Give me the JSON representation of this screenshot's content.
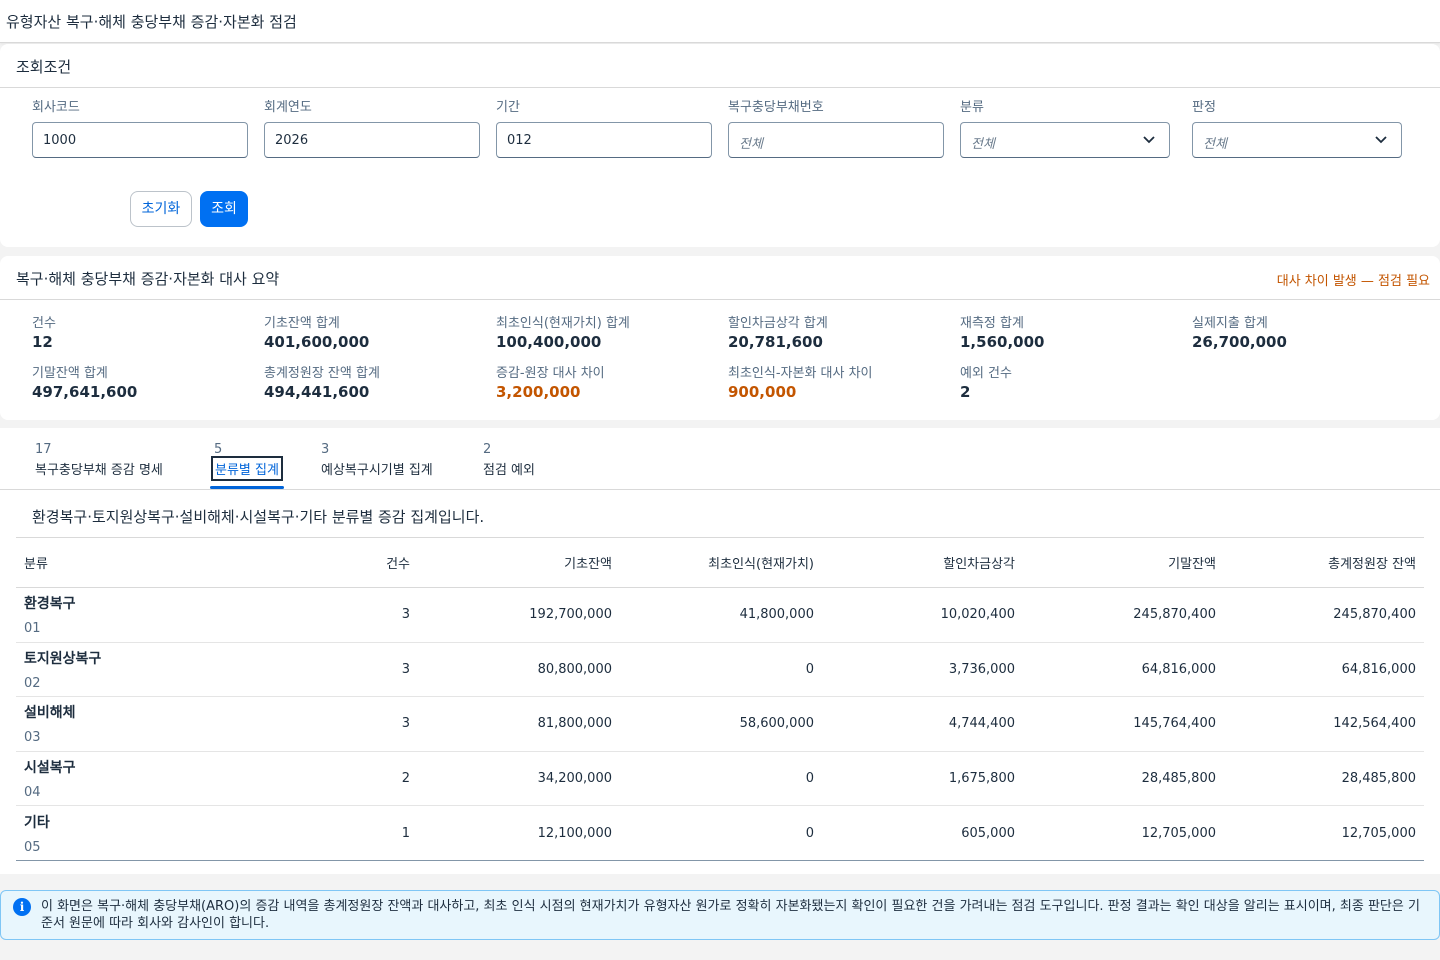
{
  "page": {
    "title": "유형자산 복구·해체 충당부채 증감·자본화 점검"
  },
  "filter": {
    "title": "조회조건",
    "fields": [
      {
        "label": "회사코드",
        "value": "1000",
        "placeholder": ""
      },
      {
        "label": "회계연도",
        "value": "2026",
        "placeholder": ""
      },
      {
        "label": "기간",
        "value": "012",
        "placeholder": ""
      },
      {
        "label": "복구충당부채번호",
        "value": "",
        "placeholder": "전체"
      },
      {
        "label": "분류",
        "value": "전체",
        "placeholder": ""
      },
      {
        "label": "판정",
        "value": "전체",
        "placeholder": ""
      }
    ],
    "reset_label": "초기화",
    "search_label": "조회"
  },
  "summary": {
    "title": "복구·해체 충당부채 증감·자본화 대사 요약",
    "warning": "대사 차이 발생 — 점검 필요",
    "kpis": [
      {
        "label": "건수",
        "value": "12"
      },
      {
        "label": "기초잔액 합계",
        "value": "401,600,000"
      },
      {
        "label": "최초인식(현재가치) 합계",
        "value": "100,400,000"
      },
      {
        "label": "할인차금상각 합계",
        "value": "20,781,600"
      },
      {
        "label": "재측정 합계",
        "value": "1,560,000"
      },
      {
        "label": "실제지출 합계",
        "value": "26,700,000"
      },
      {
        "label": "기말잔액 합계",
        "value": "497,641,600"
      },
      {
        "label": "총계정원장 잔액 합계",
        "value": "494,441,600"
      },
      {
        "label": "증감-원장 대사 차이",
        "value": "3,200,000"
      },
      {
        "label": "최초인식-자본화 대사 차이",
        "value": "900,000"
      },
      {
        "label": "예외 건수",
        "value": "2"
      }
    ]
  },
  "tabs": [
    {
      "count": "17",
      "label": "복구충당부채 증감 명세"
    },
    {
      "count": "5",
      "label": "분류별 집계"
    },
    {
      "count": "3",
      "label": "예상복구시기별 집계"
    },
    {
      "count": "2",
      "label": "점검 예외"
    }
  ],
  "content": {
    "description": "환경복구·토지원상복구·설비해체·시설복구·기타 분류별 증감 집계입니다.",
    "columns": [
      "분류",
      "건수",
      "기초잔액",
      "최초인식(현재가치)",
      "할인차금상각",
      "기말잔액",
      "총계정원장 잔액"
    ],
    "rows": [
      {
        "name": "환경복구",
        "code": "01",
        "count": "3",
        "opening": "192,700,000",
        "initial": "41,800,000",
        "accretion": "10,020,400",
        "closing": "245,870,400",
        "ledger": "245,870,400"
      },
      {
        "name": "토지원상복구",
        "code": "02",
        "count": "3",
        "opening": "80,800,000",
        "initial": "0",
        "accretion": "3,736,000",
        "closing": "64,816,000",
        "ledger": "64,816,000"
      },
      {
        "name": "설비해체",
        "code": "03",
        "count": "3",
        "opening": "81,800,000",
        "initial": "58,600,000",
        "accretion": "4,744,400",
        "closing": "145,764,400",
        "ledger": "142,564,400"
      },
      {
        "name": "시설복구",
        "code": "04",
        "count": "2",
        "opening": "34,200,000",
        "initial": "0",
        "accretion": "1,675,800",
        "closing": "28,485,800",
        "ledger": "28,485,800"
      },
      {
        "name": "기타",
        "code": "05",
        "count": "1",
        "opening": "12,100,000",
        "initial": "0",
        "accretion": "605,000",
        "closing": "12,705,000",
        "ledger": "12,705,000"
      }
    ]
  },
  "info": {
    "icon": "info-icon",
    "text": "이 화면은 복구·해체 충당부채(ARO)의 증감 내역을 총계정원장 잔액과 대사하고, 최초 인식 시점의 현재가치가 유형자산 원가로 정확히 자본화됐는지 확인이 필요한 건을 가려내는 점검 도구입니다. 판정 결과는 확인 대상을 알리는 표시이며, 최종 판단은 기준서 원문에 따라 회사와 감사인이 합니다."
  },
  "colors": {
    "accent": "#0070f2",
    "warning": "#c35500",
    "info_bg": "#e8f6fd"
  }
}
